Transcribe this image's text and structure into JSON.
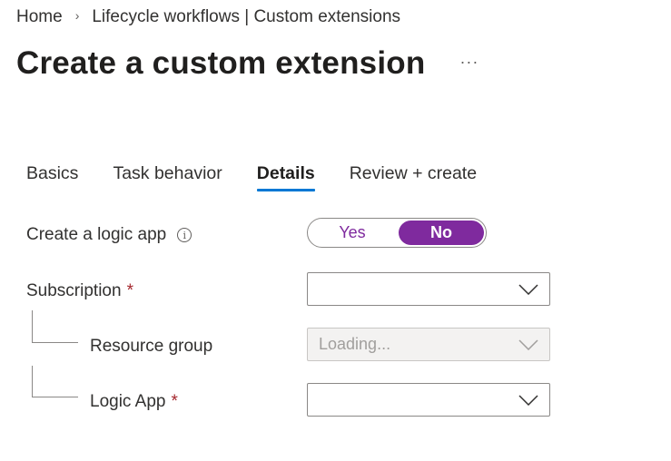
{
  "breadcrumb": {
    "home": "Home",
    "separator": "›",
    "current": "Lifecycle workflows | Custom extensions"
  },
  "page": {
    "title": "Create a custom extension",
    "more_label": "···"
  },
  "tabs": [
    {
      "label": "Basics",
      "active": false
    },
    {
      "label": "Task behavior",
      "active": false
    },
    {
      "label": "Details",
      "active": true
    },
    {
      "label": "Review + create",
      "active": false
    }
  ],
  "form": {
    "create_logic_app": {
      "label": "Create a logic app",
      "info_icon": "info-icon",
      "options": {
        "yes": "Yes",
        "no": "No"
      },
      "selected": "No"
    },
    "subscription": {
      "label": "Subscription",
      "required_mark": "*",
      "value": ""
    },
    "resource_group": {
      "label": "Resource group",
      "value": "Loading..."
    },
    "logic_app": {
      "label": "Logic App",
      "required_mark": "*",
      "value": ""
    }
  },
  "colors": {
    "accent_tab": "#0078d4",
    "toggle_selected": "#7f2a9e",
    "required": "#a4262c"
  }
}
